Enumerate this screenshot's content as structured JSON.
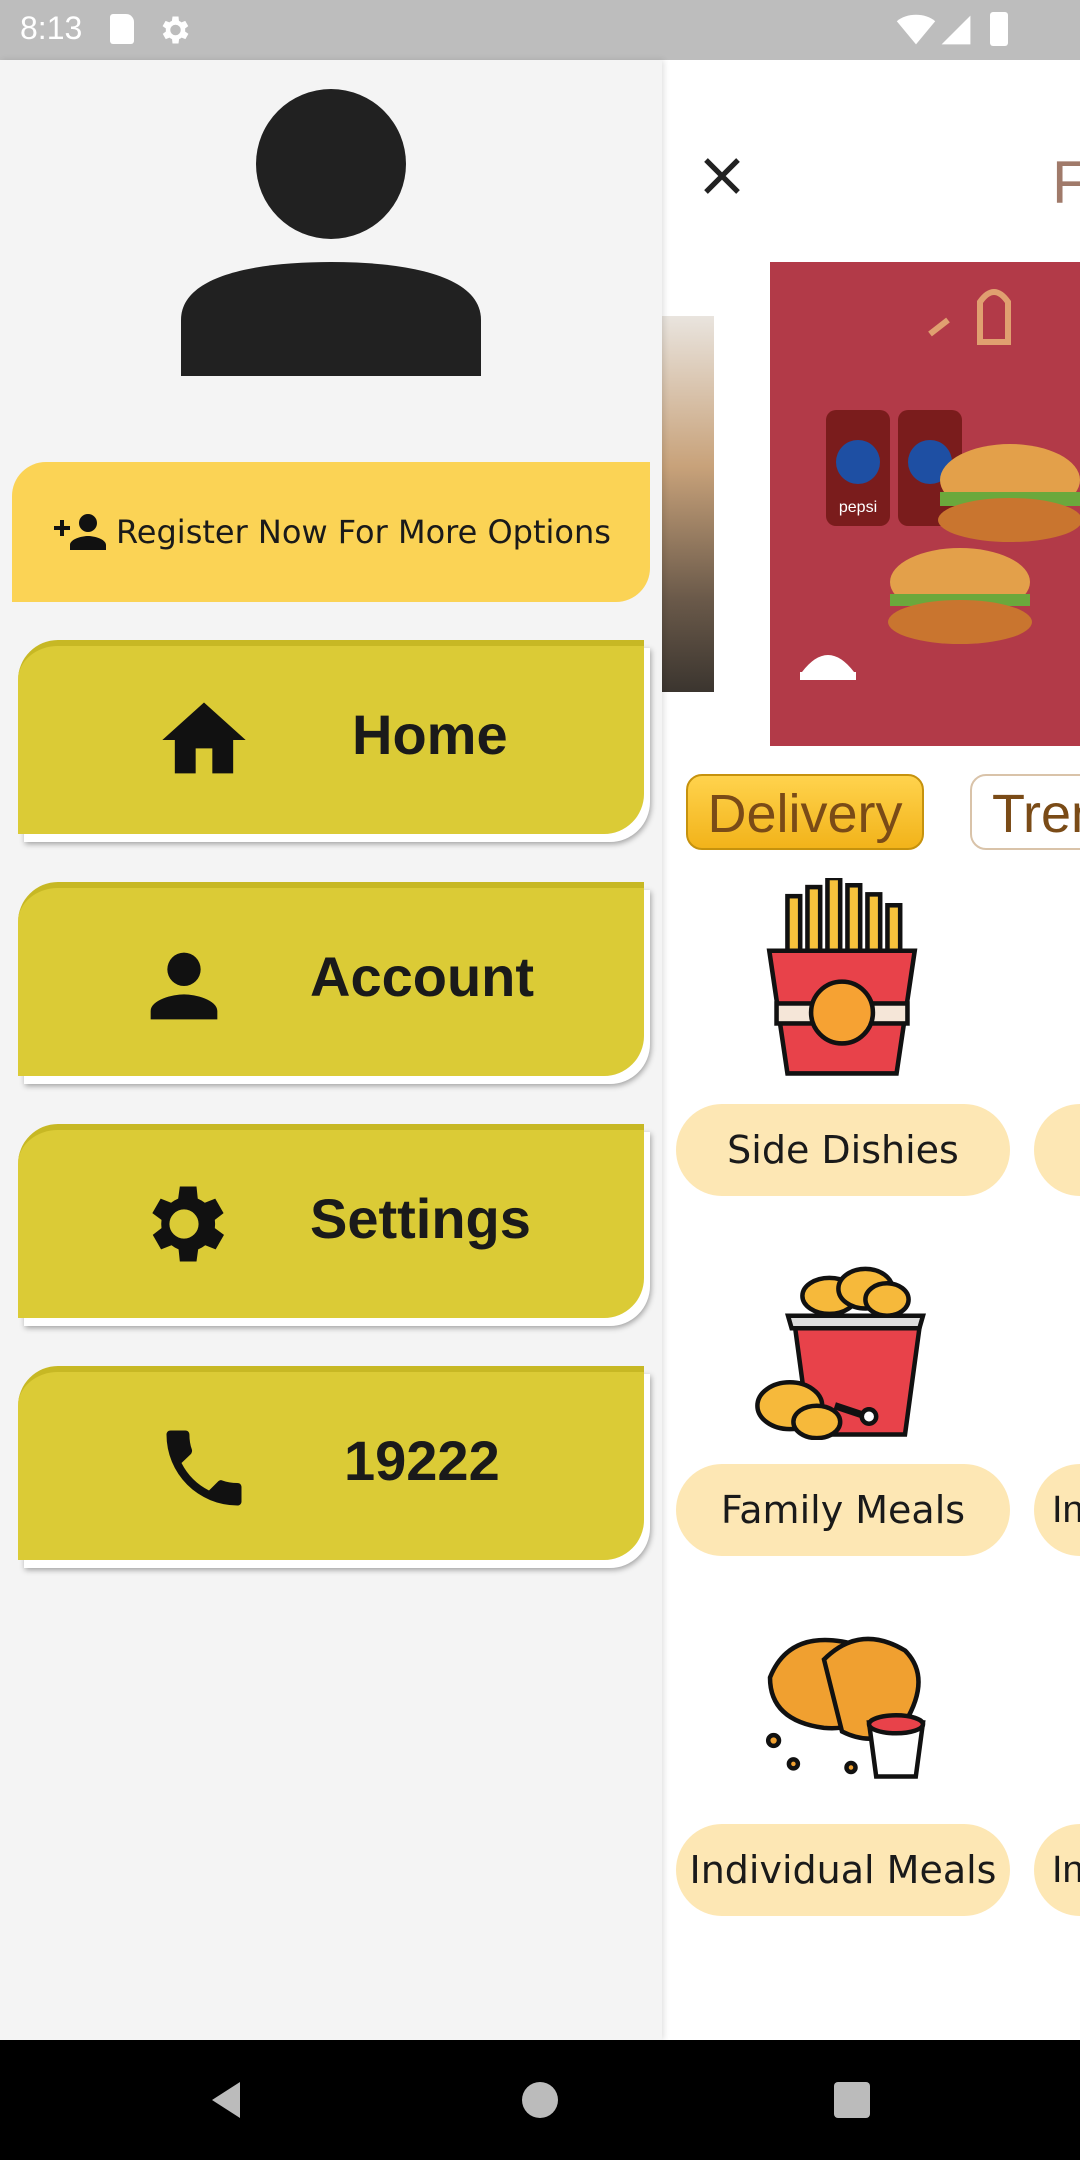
{
  "status_bar": {
    "time": "8:13",
    "icons": [
      "sd-card-icon",
      "settings-gear-icon",
      "wifi-icon",
      "signal-icon",
      "battery-icon"
    ]
  },
  "drawer": {
    "avatar_icon": "person-icon",
    "register": {
      "icon": "person-add-icon",
      "label": "Register Now For More Options"
    },
    "menu": [
      {
        "icon": "home-icon",
        "label": "Home"
      },
      {
        "icon": "person-icon",
        "label": "Account"
      },
      {
        "icon": "gear-icon",
        "label": "Settings"
      },
      {
        "icon": "phone-icon",
        "label": "19222"
      }
    ]
  },
  "main": {
    "close_icon": "close-icon",
    "title_partial": "F",
    "tabs": [
      {
        "label": "Delivery",
        "active": true
      },
      {
        "label": "Tren",
        "active": false
      }
    ],
    "banner_brand_text": "pepsi",
    "categories": [
      {
        "label": "Side Dishies",
        "icon": "fries-icon"
      },
      {
        "label": "Family Meals",
        "icon": "chicken-bucket-icon"
      },
      {
        "label": "Individual Meals",
        "icon": "chicken-sauce-icon"
      }
    ],
    "right_partial_labels": [
      "",
      "In",
      "In"
    ]
  },
  "colors": {
    "drawer_bg": "#f4f4f4",
    "register_bg": "#fbd355",
    "menu_button_bg": "#dbcb36",
    "category_pill_bg": "#fde7b4",
    "accent_brown": "#7a4b17"
  }
}
